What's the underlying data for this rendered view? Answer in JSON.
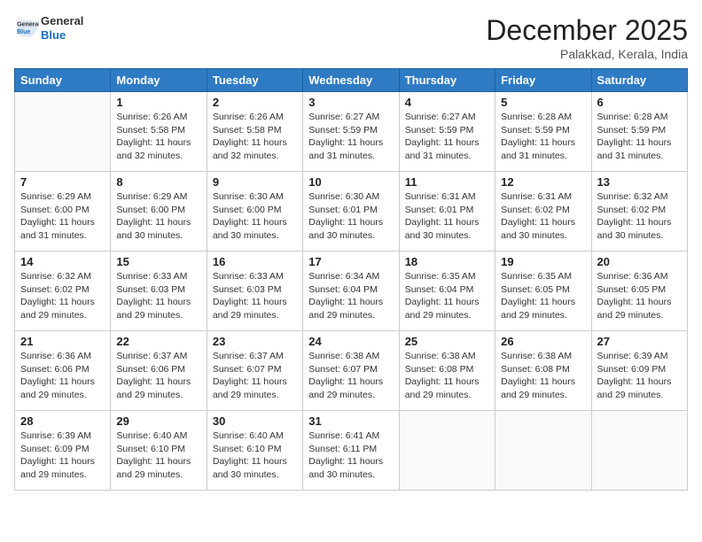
{
  "header": {
    "logo_general": "General",
    "logo_blue": "Blue",
    "month": "December 2025",
    "location": "Palakkad, Kerala, India"
  },
  "weekdays": [
    "Sunday",
    "Monday",
    "Tuesday",
    "Wednesday",
    "Thursday",
    "Friday",
    "Saturday"
  ],
  "weeks": [
    [
      {
        "day": "",
        "sunrise": "",
        "sunset": "",
        "daylight": ""
      },
      {
        "day": "1",
        "sunrise": "6:26 AM",
        "sunset": "5:58 PM",
        "daylight": "11 hours and 32 minutes."
      },
      {
        "day": "2",
        "sunrise": "6:26 AM",
        "sunset": "5:58 PM",
        "daylight": "11 hours and 32 minutes."
      },
      {
        "day": "3",
        "sunrise": "6:27 AM",
        "sunset": "5:59 PM",
        "daylight": "11 hours and 31 minutes."
      },
      {
        "day": "4",
        "sunrise": "6:27 AM",
        "sunset": "5:59 PM",
        "daylight": "11 hours and 31 minutes."
      },
      {
        "day": "5",
        "sunrise": "6:28 AM",
        "sunset": "5:59 PM",
        "daylight": "11 hours and 31 minutes."
      },
      {
        "day": "6",
        "sunrise": "6:28 AM",
        "sunset": "5:59 PM",
        "daylight": "11 hours and 31 minutes."
      }
    ],
    [
      {
        "day": "7",
        "sunrise": "6:29 AM",
        "sunset": "6:00 PM",
        "daylight": "11 hours and 31 minutes."
      },
      {
        "day": "8",
        "sunrise": "6:29 AM",
        "sunset": "6:00 PM",
        "daylight": "11 hours and 30 minutes."
      },
      {
        "day": "9",
        "sunrise": "6:30 AM",
        "sunset": "6:00 PM",
        "daylight": "11 hours and 30 minutes."
      },
      {
        "day": "10",
        "sunrise": "6:30 AM",
        "sunset": "6:01 PM",
        "daylight": "11 hours and 30 minutes."
      },
      {
        "day": "11",
        "sunrise": "6:31 AM",
        "sunset": "6:01 PM",
        "daylight": "11 hours and 30 minutes."
      },
      {
        "day": "12",
        "sunrise": "6:31 AM",
        "sunset": "6:02 PM",
        "daylight": "11 hours and 30 minutes."
      },
      {
        "day": "13",
        "sunrise": "6:32 AM",
        "sunset": "6:02 PM",
        "daylight": "11 hours and 30 minutes."
      }
    ],
    [
      {
        "day": "14",
        "sunrise": "6:32 AM",
        "sunset": "6:02 PM",
        "daylight": "11 hours and 29 minutes."
      },
      {
        "day": "15",
        "sunrise": "6:33 AM",
        "sunset": "6:03 PM",
        "daylight": "11 hours and 29 minutes."
      },
      {
        "day": "16",
        "sunrise": "6:33 AM",
        "sunset": "6:03 PM",
        "daylight": "11 hours and 29 minutes."
      },
      {
        "day": "17",
        "sunrise": "6:34 AM",
        "sunset": "6:04 PM",
        "daylight": "11 hours and 29 minutes."
      },
      {
        "day": "18",
        "sunrise": "6:35 AM",
        "sunset": "6:04 PM",
        "daylight": "11 hours and 29 minutes."
      },
      {
        "day": "19",
        "sunrise": "6:35 AM",
        "sunset": "6:05 PM",
        "daylight": "11 hours and 29 minutes."
      },
      {
        "day": "20",
        "sunrise": "6:36 AM",
        "sunset": "6:05 PM",
        "daylight": "11 hours and 29 minutes."
      }
    ],
    [
      {
        "day": "21",
        "sunrise": "6:36 AM",
        "sunset": "6:06 PM",
        "daylight": "11 hours and 29 minutes."
      },
      {
        "day": "22",
        "sunrise": "6:37 AM",
        "sunset": "6:06 PM",
        "daylight": "11 hours and 29 minutes."
      },
      {
        "day": "23",
        "sunrise": "6:37 AM",
        "sunset": "6:07 PM",
        "daylight": "11 hours and 29 minutes."
      },
      {
        "day": "24",
        "sunrise": "6:38 AM",
        "sunset": "6:07 PM",
        "daylight": "11 hours and 29 minutes."
      },
      {
        "day": "25",
        "sunrise": "6:38 AM",
        "sunset": "6:08 PM",
        "daylight": "11 hours and 29 minutes."
      },
      {
        "day": "26",
        "sunrise": "6:38 AM",
        "sunset": "6:08 PM",
        "daylight": "11 hours and 29 minutes."
      },
      {
        "day": "27",
        "sunrise": "6:39 AM",
        "sunset": "6:09 PM",
        "daylight": "11 hours and 29 minutes."
      }
    ],
    [
      {
        "day": "28",
        "sunrise": "6:39 AM",
        "sunset": "6:09 PM",
        "daylight": "11 hours and 29 minutes."
      },
      {
        "day": "29",
        "sunrise": "6:40 AM",
        "sunset": "6:10 PM",
        "daylight": "11 hours and 29 minutes."
      },
      {
        "day": "30",
        "sunrise": "6:40 AM",
        "sunset": "6:10 PM",
        "daylight": "11 hours and 30 minutes."
      },
      {
        "day": "31",
        "sunrise": "6:41 AM",
        "sunset": "6:11 PM",
        "daylight": "11 hours and 30 minutes."
      },
      {
        "day": "",
        "sunrise": "",
        "sunset": "",
        "daylight": ""
      },
      {
        "day": "",
        "sunrise": "",
        "sunset": "",
        "daylight": ""
      },
      {
        "day": "",
        "sunrise": "",
        "sunset": "",
        "daylight": ""
      }
    ]
  ]
}
